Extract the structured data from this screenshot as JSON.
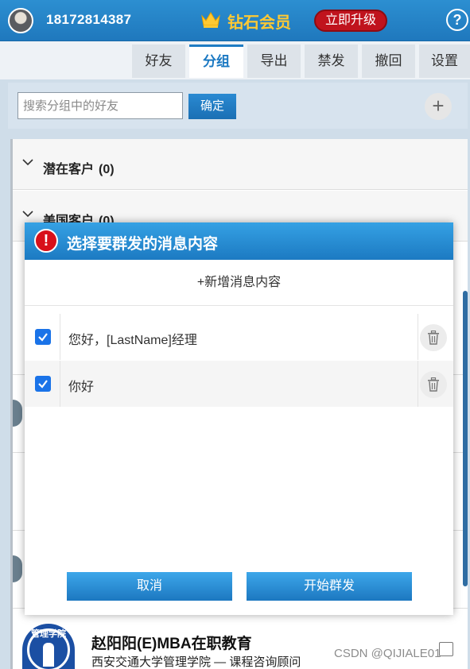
{
  "header": {
    "phone": "18172814387",
    "vip_title": "钻石会员",
    "upgrade_label": "立即升级",
    "help_label": "?"
  },
  "tabs": [
    {
      "label": "好友"
    },
    {
      "label": "分组"
    },
    {
      "label": "导出"
    },
    {
      "label": "禁发"
    },
    {
      "label": "撤回"
    },
    {
      "label": "设置"
    }
  ],
  "active_tab": "分组",
  "search": {
    "placeholder": "搜索分组中的好友",
    "confirm_label": "确定",
    "add_label": "+"
  },
  "groups": [
    {
      "name": "潜在客户",
      "count": "(0)"
    },
    {
      "name": "美国客户",
      "count": "(0)"
    }
  ],
  "contact": {
    "avatar_text": "管理学院",
    "name": "赵阳阳(E)MBA在职教育",
    "desc": "西安交通大学管理学院 — 课程咨询顾问"
  },
  "watermark": "CSDN @QIJIALE01",
  "dialog": {
    "icon": "!",
    "title": "选择要群发的消息内容",
    "add_content_label": "+新增消息内容",
    "messages": [
      {
        "text": "您好，[LastName]经理",
        "checked": true
      },
      {
        "text": "你好",
        "checked": true
      }
    ],
    "cancel_label": "取消",
    "start_label": "开始群发"
  },
  "colors": {
    "header_blue": "#1f78bd",
    "accent_blue": "#1a78c2",
    "vip_gold": "#ffc933",
    "upgrade_red": "#c0131d",
    "warn_red": "#d8101a",
    "checkbox_blue": "#1a73e8"
  }
}
